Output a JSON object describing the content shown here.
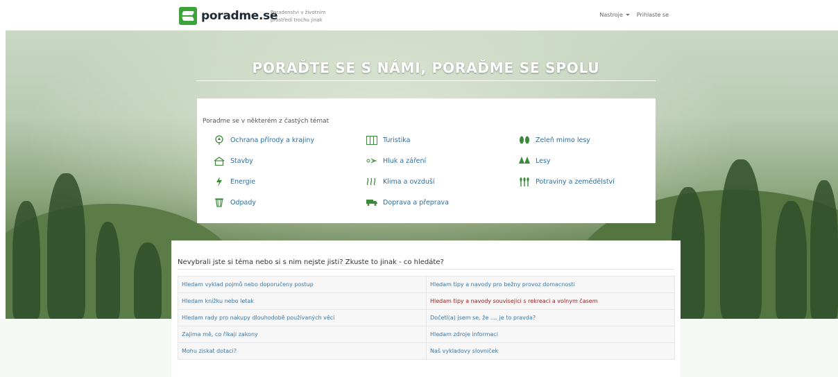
{
  "header": {
    "logo_text": "poradme.se",
    "tagline": "Poradenstvi v životním prostředí trochu jinak",
    "nav": [
      {
        "label": "Nastroje"
      },
      {
        "label": "Prihlaste se"
      }
    ]
  },
  "hero": {
    "title": "PORAĎTE SE S NÁMI, PORAĎME SE SPOLU"
  },
  "topics": {
    "heading": "Poradme se v některém z častých témat",
    "items": [
      {
        "label": "Ochrana přírody a krajiny",
        "icon": "nature-protection-icon"
      },
      {
        "label": "Turistika",
        "icon": "tourism-map-icon"
      },
      {
        "label": "Zeleň mimo lesy",
        "icon": "greenery-icon"
      },
      {
        "label": "Stavby",
        "icon": "building-icon"
      },
      {
        "label": "Hluk a záření",
        "icon": "noise-icon"
      },
      {
        "label": "Lesy",
        "icon": "forest-icon"
      },
      {
        "label": "Energie",
        "icon": "energy-icon"
      },
      {
        "label": "Klima a ovzduší",
        "icon": "climate-icon"
      },
      {
        "label": "Potraviny a zemědělství",
        "icon": "agriculture-icon"
      },
      {
        "label": "Odpady",
        "icon": "waste-bin-icon"
      },
      {
        "label": "Doprava a přeprava",
        "icon": "transport-truck-icon"
      }
    ]
  },
  "search": {
    "heading": "Nevybrali jste si téma nebo si s nim nejste jisti? Zkuste to jinak - co hledáte?",
    "rows": [
      [
        "Hledam vyklad pojmů nebo doporučeny postup",
        "Hledam tipy a navody pro bežny provoz domacnosti"
      ],
      [
        "Hledam knížku nebo letak",
        "Hledam tipy a navody souvisejici s rekreaci a volnym časem"
      ],
      [
        "Hledam rady pro nakupy dlouhodobě používaných věci",
        "Dočetl(a) jsem se, že .... je to pravda?"
      ],
      [
        "Zajima mě, co říkaji zakony",
        "Hledam zdroje informaci"
      ],
      [
        "Mohu ziskat dotaci?",
        "Naš vykladovy slovniček"
      ]
    ]
  },
  "colors": {
    "brand_green": "#3ba33a",
    "link_blue": "#2e6e9e",
    "highlight_red": "#9a1a1a"
  }
}
